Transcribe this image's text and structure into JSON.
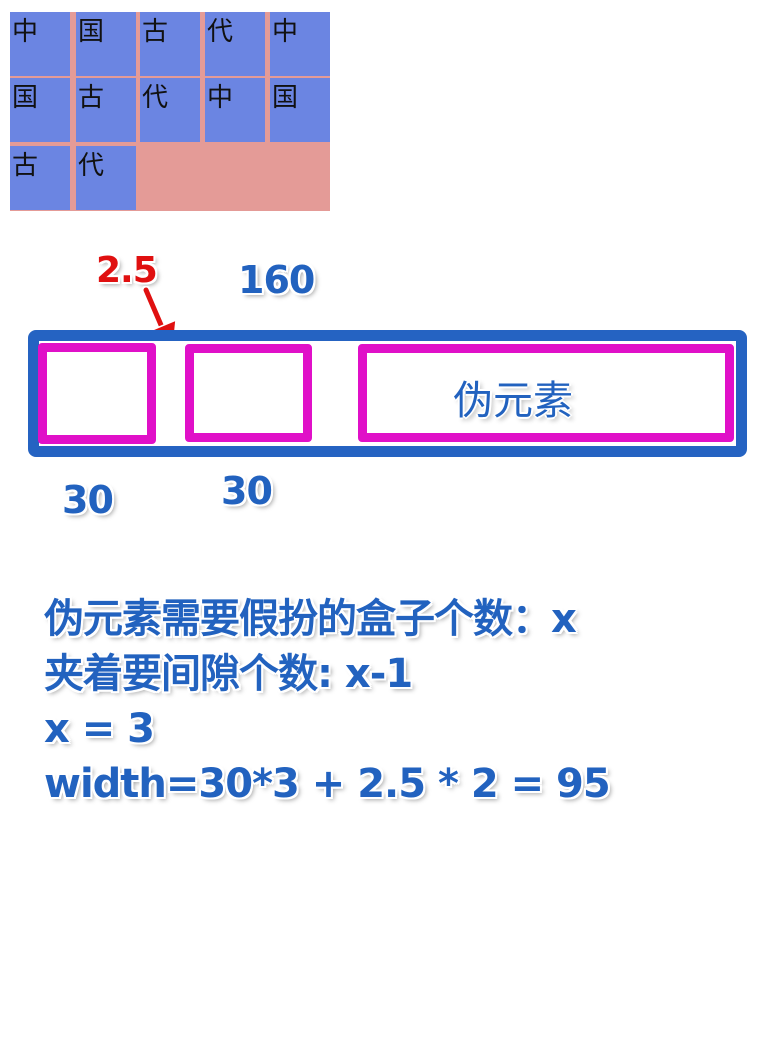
{
  "grid": {
    "cells": [
      "中",
      "国",
      "古",
      "代",
      "中",
      "国",
      "古",
      "代",
      "中",
      "国",
      "古",
      "代"
    ]
  },
  "diagram": {
    "gap_label": "2.5",
    "total_width_label": "160",
    "box1_width_label": "30",
    "box2_width_label": "30",
    "pseudo_element_label": "伪元素"
  },
  "notes": {
    "lines": [
      "伪元素需要假扮的盒子个数：x",
      "夹着要间隙个数: x-1",
      "x = 3",
      "width=30*3 + 2.5 * 2 = 95"
    ]
  },
  "colors": {
    "cell_bg": "#6b85e2",
    "grid_bg": "#e49b97",
    "outer_border": "#2563c2",
    "inner_border": "#e010c8",
    "label_blue": "#2262bf",
    "label_red": "#e01010"
  }
}
